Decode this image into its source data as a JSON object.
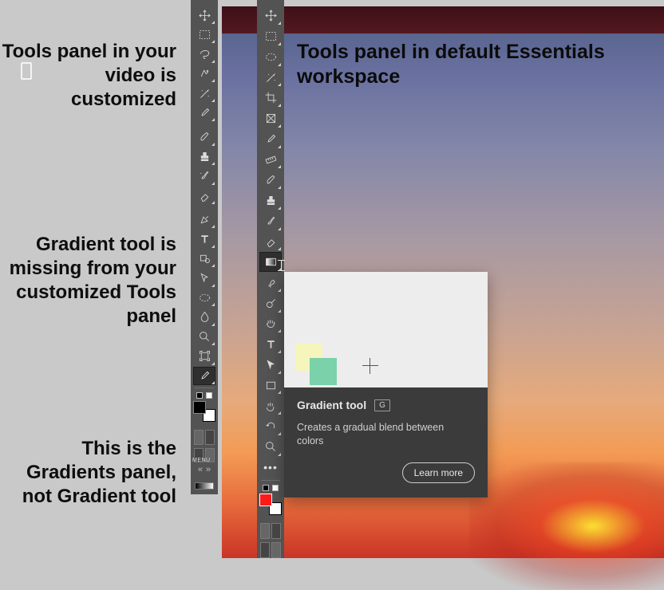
{
  "annotations": {
    "a1": "Tools panel in your video is customized",
    "a2": "Gradient tool is missing from your customized Tools panel",
    "a3": "This is the Gradients panel, not Gradient tool"
  },
  "sky_label": "Tools panel in default Essentials workspace",
  "tooltip": {
    "title": "Gradient tool",
    "shortcut": "G",
    "description": "Creates a gradual blend between colors",
    "learn_more": "Learn more"
  },
  "left_toolbar": {
    "tools": [
      "move",
      "marquee",
      "lasso",
      "quick-select",
      "magic-wand",
      "eyedropper",
      "brush",
      "stamp",
      "eraser",
      "pen",
      "type",
      "shape",
      "path-select",
      "ellipse",
      "blur",
      "zoom",
      "artboard"
    ],
    "highlighted": 16,
    "foreground": "#000000",
    "background": "#ffffff",
    "menu_label": "MENU"
  },
  "right_toolbar": {
    "tools": [
      "move",
      "artboard",
      "marquee",
      "lasso",
      "magic-wand",
      "crop",
      "frame",
      "eyedropper",
      "ruler",
      "brush",
      "clone-stamp",
      "history-brush",
      "eraser",
      "gradient",
      "smudge",
      "dodge",
      "hand",
      "type",
      "path-select",
      "rectangle",
      "hand2",
      "rotate-view",
      "zoom",
      "more"
    ],
    "hovered": 13,
    "foreground": "#ff1a1a",
    "background": "#ffffff"
  }
}
